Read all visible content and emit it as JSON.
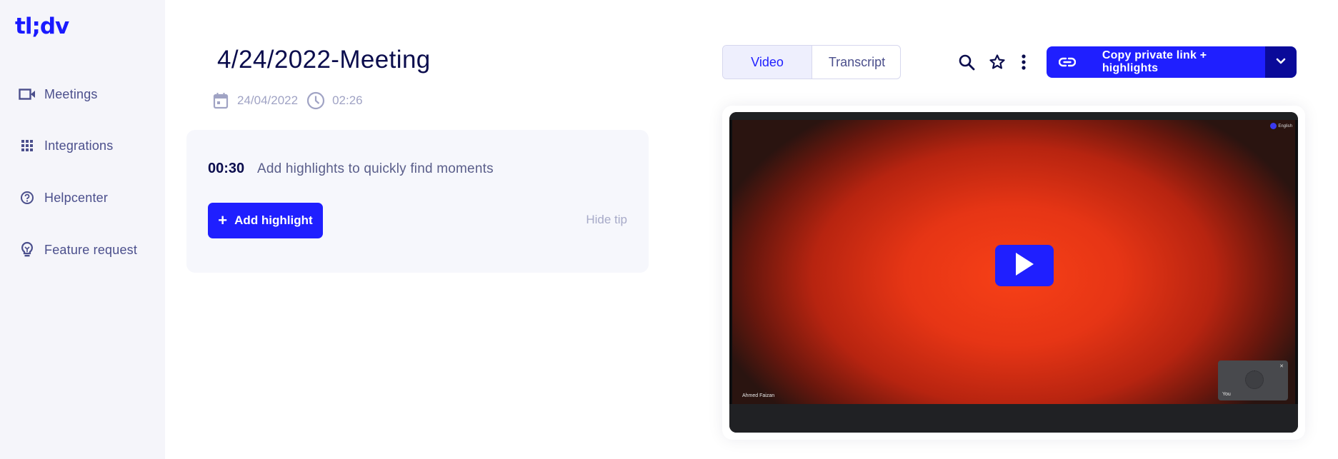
{
  "app": {
    "logo": "tl;dv",
    "brand_color": "#1f1fff"
  },
  "sidebar": {
    "items": [
      {
        "label": "Meetings",
        "icon": "video-camera-icon"
      },
      {
        "label": "Integrations",
        "icon": "grid-icon"
      },
      {
        "label": "Helpcenter",
        "icon": "help-circle-icon"
      },
      {
        "label": "Feature request",
        "icon": "lightbulb-icon"
      }
    ]
  },
  "meeting": {
    "title": "4/24/2022-Meeting",
    "date": "24/04/2022",
    "duration": "02:26"
  },
  "tip": {
    "time": "00:30",
    "text": "Add highlights to quickly find moments",
    "add_button": "Add highlight",
    "hide_label": "Hide tip"
  },
  "tabs": [
    {
      "label": "Video",
      "active": true
    },
    {
      "label": "Transcript",
      "active": false
    }
  ],
  "toolbar": {
    "copy_label": "Copy private link + highlights"
  },
  "video": {
    "participant_name": "Ahmed Faizan",
    "self_label": "You",
    "language": "English"
  }
}
